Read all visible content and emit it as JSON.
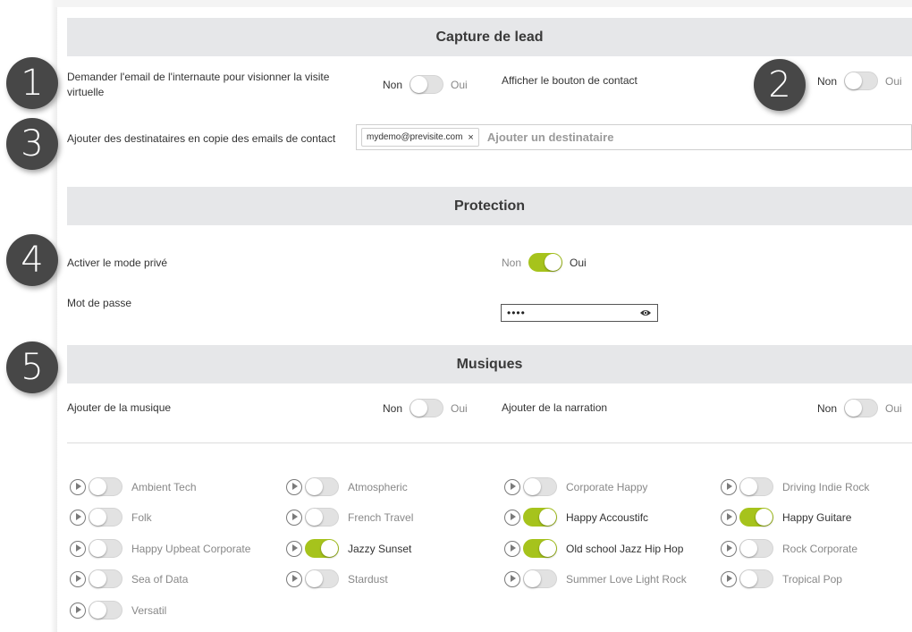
{
  "sections": {
    "lead": {
      "title": "Capture de lead"
    },
    "protection": {
      "title": "Protection"
    },
    "music": {
      "title": "Musiques"
    }
  },
  "lead": {
    "email_request": {
      "label": "Demander l'email de l'internaute pour visionner la visite virtuelle",
      "off": "Non",
      "on": "Oui",
      "state": false
    },
    "contact_button": {
      "label": "Afficher le bouton de contact",
      "off": "Non",
      "on": "Oui",
      "state": false
    },
    "cc_recipients": {
      "label": "Ajouter des destinataires en copie des emails de contact",
      "chips": [
        "mydemo@previsite.com"
      ],
      "chip_remove": "×",
      "placeholder": "Ajouter un destinataire"
    }
  },
  "protection": {
    "private_mode": {
      "label": "Activer le mode privé",
      "off": "Non",
      "on": "Oui",
      "state": true
    },
    "password": {
      "label": "Mot de passe",
      "value": "••••"
    }
  },
  "music": {
    "add_music": {
      "label": "Ajouter de la musique",
      "off": "Non",
      "on": "Oui",
      "state": false
    },
    "add_narration": {
      "label": "Ajouter de la narration",
      "off": "Non",
      "on": "Oui",
      "state": false
    },
    "tracks": [
      {
        "name": "Ambient Tech",
        "on": false
      },
      {
        "name": "Atmospheric",
        "on": false
      },
      {
        "name": "Corporate Happy",
        "on": false
      },
      {
        "name": "Driving Indie Rock",
        "on": false
      },
      {
        "name": "Folk",
        "on": false
      },
      {
        "name": "French Travel",
        "on": false
      },
      {
        "name": "Happy Accoustifc",
        "on": true
      },
      {
        "name": "Happy Guitare",
        "on": true
      },
      {
        "name": "Happy Upbeat Corporate",
        "on": false
      },
      {
        "name": "Jazzy Sunset",
        "on": true
      },
      {
        "name": "Old school Jazz Hip Hop",
        "on": true
      },
      {
        "name": "Rock Corporate",
        "on": false
      },
      {
        "name": "Sea of Data",
        "on": false
      },
      {
        "name": "Stardust",
        "on": false
      },
      {
        "name": "Summer Love Light Rock",
        "on": false
      },
      {
        "name": "Tropical Pop",
        "on": false
      },
      {
        "name": "Versatil",
        "on": false
      }
    ]
  },
  "badges": [
    "1",
    "2",
    "3",
    "4",
    "5"
  ],
  "colors": {
    "accent": "#a6c31c",
    "header_bg": "#e6e7e9",
    "badge_bg": "#474747"
  }
}
